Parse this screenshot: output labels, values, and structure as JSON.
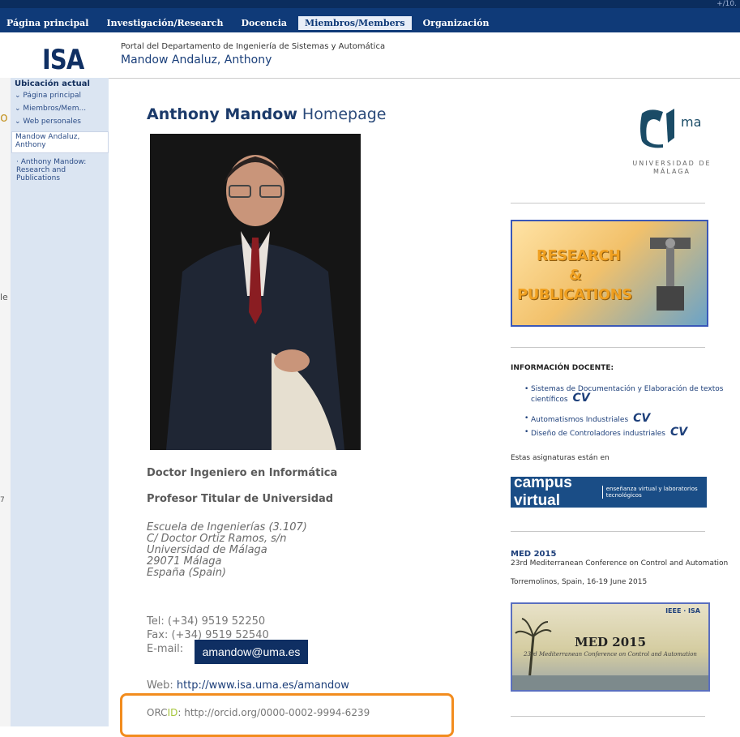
{
  "nav": {
    "items": [
      "Página principal",
      "Investigación/Research",
      "Docencia",
      "Miembros/Members",
      "Organización"
    ],
    "active_index": 3,
    "corner_text": "+/10."
  },
  "header": {
    "logo_text": "ISA",
    "portal": "Portal del Departamento de Ingeniería de Sistemas y Automática",
    "person": "Mandow Andaluz, Anthony"
  },
  "sidebar": {
    "title": "Ubicación actual",
    "crumbs": [
      "Página principal",
      "Miembros/Mem...",
      "Web personales"
    ],
    "current": "Mandow Andaluz, Anthony",
    "sub": "Anthony Mandow: Research and Publications"
  },
  "left_fragments": [
    "le",
    "o",
    "7"
  ],
  "main": {
    "title_bold": "Anthony Mandow",
    "title_rest": " Homepage",
    "degree": "Doctor Ingeniero en Informática",
    "position": "Profesor Titular de Universidad",
    "address": [
      "Escuela de Ingenierías (3.107)",
      "C/ Doctor Ortiz Ramos, s/n",
      "Universidad de Málaga",
      "29071 Málaga",
      "España (Spain)"
    ],
    "tel": "Tel: (+34) 9519 52250",
    "fax": "Fax:  (+34)  9519 52540",
    "email_label": "E-mail:",
    "email": "amandow@uma.es",
    "web_label": "Web:  ",
    "web_url": "http://www.isa.uma.es/amandow",
    "orcid_prefix": "ORC",
    "orcid_id": "ID",
    "orcid_rest": ": http://orcid.org/0000-0002-9994-6239"
  },
  "right": {
    "uma_mark": "ma",
    "uma_text": "UNIVERSIDAD DE MÁLAGA",
    "research_lines": [
      "RESEARCH",
      "&",
      "PUBLICATIONS"
    ],
    "docente_title": "INFORMACIÓN DOCENTE:",
    "courses": [
      "Sistemas de Documentación y Elaboración de textos científicos",
      "Automatismos Industriales",
      "Diseño de Controladores industriales"
    ],
    "cv_mark": "CV",
    "estas": "Estas asignaturas están en",
    "campus_big": "campus virtual",
    "campus_small": "enseñanza virtual y laboratorios tecnológicos",
    "med_title": "MED 2015",
    "med_desc": "23rd Mediterranean Conference on Control and Automation",
    "med_place": "Torremolinos, Spain, 16-19 June 2015",
    "med_img_title": "MED 2015",
    "med_img_sub": "23rd Mediterranean Conference on Control and Automation",
    "med_img_logos": "IEEE · ISA"
  },
  "colors": {
    "nav_bg": "#0f3a78",
    "sidebar_bg": "#dbe5f2",
    "orcid_box": "#f28c1e",
    "orcid_id": "#a5c63b"
  }
}
